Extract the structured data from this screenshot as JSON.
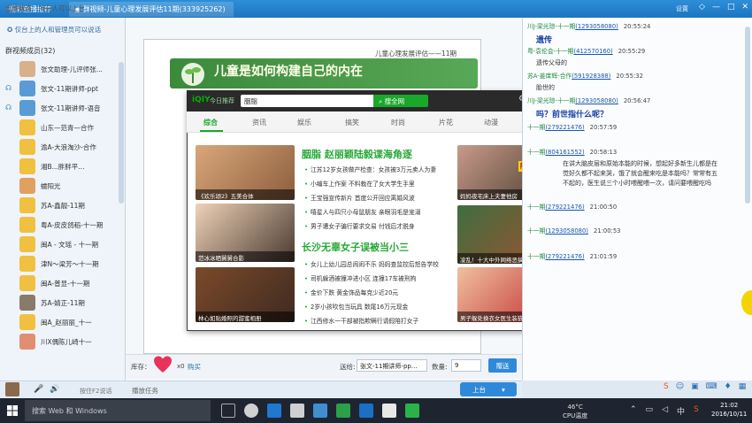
{
  "top_bar": {
    "tab1": "畅彩直播推荐",
    "tab2": "群视频-儿童心理发展评估11期(333925262)",
    "right_label": "设置"
  },
  "left_panel": {
    "title": "主席模式",
    "notice": "仅台上的人和管理员可以说话",
    "member_count_label": "群视频成员(32)",
    "members": [
      {
        "name": "张文助理-儿评师张...",
        "color": "#d8b08a"
      },
      {
        "name": "张文-11期讲师-ppt",
        "color": "#5b9bd5"
      },
      {
        "name": "张文-11期讲师-语音",
        "color": "#5b9bd5"
      },
      {
        "name": "山东—范青—合作",
        "color": "#f0c040"
      },
      {
        "name": "渝A-大浪淘沙-合作",
        "color": "#f0c040"
      },
      {
        "name": "湘B...胖胖平...",
        "color": "#f0c040"
      },
      {
        "name": "蠕阳光",
        "color": "#e0a060"
      },
      {
        "name": "苏A-鑫靓-11期",
        "color": "#f0c040"
      },
      {
        "name": "粤A-皮皮鸽稻-十一期",
        "color": "#f0c040"
      },
      {
        "name": "闽A - 文瑶 - 十一期",
        "color": "#f0c040"
      },
      {
        "name": "津N～梁芳～十一期",
        "color": "#f0c040"
      },
      {
        "name": "闽A-普显-十一期",
        "color": "#f0c040"
      },
      {
        "name": "苏A-婧正-11期",
        "color": "#8a7a6a"
      },
      {
        "name": "闽A_赵丽丽_十一",
        "color": "#f0c040"
      },
      {
        "name": "川X偶陈儿崎十一",
        "color": "#e09070"
      }
    ],
    "bottom_label": "按住F2说话"
  },
  "middle": {
    "status": "当前状态：所有人可以上台",
    "slide_header": "儿童心理发展评估——11期",
    "slide_title": "儿童是如何构建自己的内在",
    "gift_label": "库存：",
    "gift_count": "x0",
    "buy_label": "购买",
    "send_label": "送给:",
    "send_target": "张文-11期讲师-pp...",
    "qty_label": "数量:",
    "qty_value": "9",
    "give_button": "赠送",
    "queue_label": "播放任务",
    "on_mic_button": "上台"
  },
  "chat": {
    "lines": [
      {
        "name": "川J-梁光琼-十一期",
        "id": "(1293058080)",
        "time": "20:55:24",
        "msg": "遗传",
        "big": true
      },
      {
        "name": "粤-袁伦会-十一期",
        "id": "(412570160)",
        "time": "20:55:29",
        "msg": "遗传父母的",
        "big": false
      },
      {
        "name": "苏A-姜庠辉-合作",
        "id": "(591928388)",
        "time": "20:55:32",
        "msg": "胎世的",
        "big": false
      },
      {
        "name": "川J-梁光琼-十一期",
        "id": "(1293058080)",
        "time": "20:56:47",
        "msg": "吗？前世指什么呢？",
        "big": true
      },
      {
        "name": "十一期",
        "id": "(279221476)",
        "time": "20:57:59",
        "msg": "",
        "big": false
      },
      {
        "name": "十一期",
        "id": "(804161552)",
        "time": "20:58:13",
        "msg": "在讲大脑皮层和原始本能的时候，想起好多新生儿都是在",
        "big": false
      },
      {
        "name": "",
        "id": "",
        "time": "",
        "msg": "觉好久都不起来哭，饿了就会醒来吃是本能吗？常常有五",
        "big": false
      },
      {
        "name": "",
        "id": "",
        "time": "",
        "msg": "不起的，医生说三个小时喂醒喂一次，请问要喂醒吃吗",
        "big": false
      },
      {
        "name": "十一期",
        "id": "(279221476)",
        "time": "21:00:50",
        "msg": "",
        "big": false
      },
      {
        "name": "十一期",
        "id": "(1293058080)",
        "time": "21:00:53",
        "msg": "",
        "big": false
      },
      {
        "name": "十一期",
        "id": "(279221476)",
        "time": "21:01:59",
        "msg": "",
        "big": false
      }
    ]
  },
  "popup": {
    "logo": "iQIY",
    "logo_sub": "今日推荐",
    "search_value": "胭脂",
    "search_button": "搜全网",
    "nav": [
      "综合",
      "资讯",
      "娱乐",
      "搞笑",
      "时尚",
      "片花",
      "动漫",
      "全球购"
    ],
    "headline1": "胭脂  赵丽颖陆毅谍海角逐",
    "list1": [
      "江苏12岁女孩做产检查：女孩被3万元卖人为妻",
      "小编车上作案 不料栽在了女大学生手里",
      "王宝强宣传新片 首度公开回应离婚风波",
      "嘻星人与四只小母鼠朋友 亲眼羽毛是宠溺",
      "男子遭女子骗行要求交易 付钱后才脱身"
    ],
    "headline2": "长沙无辜女子误被当小三",
    "list2": [
      "女儿上幼儿园总闹闹不乐 妈妈查监控后怒告学校",
      "司机躲酒被撞冲进小区 连撞17车被刑拘",
      "金价下跌 黄金饰品每克少近20元",
      "2岁小孩吹包当玩具 数尾16万元现金",
      "江西修水一干部被指欺瞒行请假陪打女子"
    ],
    "thumbs": [
      {
        "caption": "《欢乐颂2》五美合体",
        "color1": "#d9a77a",
        "color2": "#8b5e3c"
      },
      {
        "caption": "范冰冰晒舅舅合影",
        "color1": "#efd2b8",
        "color2": "#4a3a30"
      },
      {
        "caption": "林心如贴婚照的甜蜜相册",
        "color1": "#7b4a2a",
        "color2": "#3e2a20"
      },
      {
        "caption": "妈妈夜宅床上夫妻他房",
        "color1": "#c99a8a",
        "color2": "#4a4030"
      },
      {
        "caption": "凌乱！十大中外网络恶搞",
        "color1": "#3f6e3f",
        "color2": "#a05030"
      },
      {
        "caption": "男子躲处换衣女医生装猫",
        "color1": "#f0c0a0",
        "color2": "#c03030"
      }
    ],
    "thumb_extra": "陈翔六点半"
  },
  "taskbar": {
    "search_placeholder": "搜索 Web 和 Windows",
    "temp": "46°C",
    "temp_label": "CPU温度",
    "time": "21:02",
    "date": "2016/10/11"
  }
}
